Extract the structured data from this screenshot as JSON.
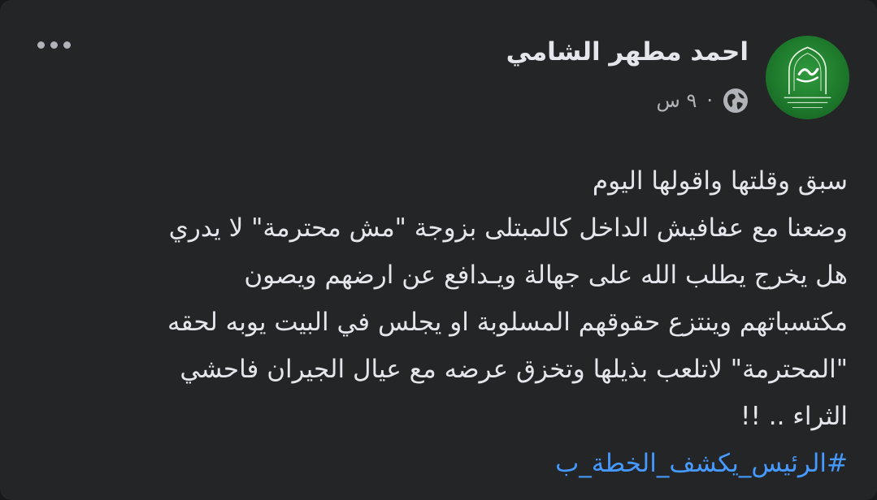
{
  "post": {
    "author_name": "احمد مطهر الشامي",
    "timestamp": "٩ س",
    "separator": "·",
    "privacy_icon": "globe-icon",
    "more_icon": "more-options-icon",
    "avatar_icon": "avatar-logo-icon",
    "body_lines": [
      "سبق وقلتها واقولها اليوم",
      "وضعنا مع عفافيش الداخل كالمبتلى بزوجة \"مش محترمة\" لا يدري",
      "هل يخرج يطلب الله على جهالة ويـدافع عن ارضهم ويصون",
      "مكتسباتهم وينتزع حقوقهم المسلوبة او يجلس في البيت يوبه لحقه",
      "\"المحترمة\" لاتلعب بذيلها وتخزق عرضه مع عيال الجيران فاحشي",
      "الثراء .. !!"
    ],
    "hashtag": "#الرئيس_يكشف_الخطة_ب"
  },
  "colors": {
    "card_background": "#242526",
    "primary_text": "#e4e6eb",
    "secondary_text": "#b0b3b8",
    "link": "#4599ff",
    "avatar_green": "#1e7a2c"
  }
}
